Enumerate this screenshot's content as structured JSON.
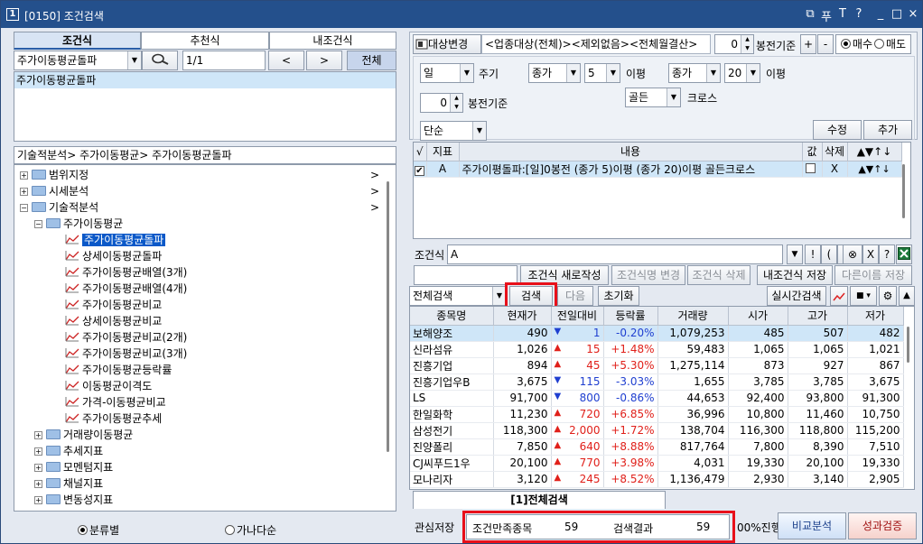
{
  "window": {
    "num": "1",
    "title": "[0150] 조건검색",
    "buttons": [
      "⧉",
      "푸",
      "T",
      "?",
      "_",
      "□",
      "×"
    ]
  },
  "left": {
    "tabs": [
      "조건식",
      "추천식",
      "내조건식"
    ],
    "search_combo": "주가이동평균돌파",
    "page": "1/1",
    "prev": "<",
    "next": ">",
    "all_btn": "전체",
    "selected_item": "주가이동평균돌파",
    "path": "기술적분석> 주가이동평균> 주가이동평균돌파",
    "tree": [
      {
        "label": "범위지정",
        "level": 0,
        "type": "folder",
        "arrow": ">"
      },
      {
        "label": "시세분석",
        "level": 0,
        "type": "folder",
        "arrow": ">"
      },
      {
        "label": "기술적분석",
        "level": 0,
        "type": "folder-open",
        "arrow": ">"
      },
      {
        "label": "주가이동평균",
        "level": 1,
        "type": "folder-open",
        "arrow": ""
      },
      {
        "label": "주가이동평균돌파",
        "level": 2,
        "type": "item",
        "selected": true
      },
      {
        "label": "상세이동평균돌파",
        "level": 2,
        "type": "item"
      },
      {
        "label": "주가이동평균배열(3개)",
        "level": 2,
        "type": "item"
      },
      {
        "label": "주가이동평균배열(4개)",
        "level": 2,
        "type": "item"
      },
      {
        "label": "주가이동평균비교",
        "level": 2,
        "type": "item"
      },
      {
        "label": "상세이동평균비교",
        "level": 2,
        "type": "item"
      },
      {
        "label": "주가이동평균비교(2개)",
        "level": 2,
        "type": "item"
      },
      {
        "label": "주가이동평균비교(3개)",
        "level": 2,
        "type": "item"
      },
      {
        "label": "주가이동평균등락률",
        "level": 2,
        "type": "item"
      },
      {
        "label": "이동평균이격도",
        "level": 2,
        "type": "item"
      },
      {
        "label": "가격-이동평균비교",
        "level": 2,
        "type": "item"
      },
      {
        "label": "주가이동평균추세",
        "level": 2,
        "type": "item"
      },
      {
        "label": "거래량이동평균",
        "level": 1,
        "type": "folder"
      },
      {
        "label": "추세지표",
        "level": 1,
        "type": "folder"
      },
      {
        "label": "모멘텀지표",
        "level": 1,
        "type": "folder"
      },
      {
        "label": "채널지표",
        "level": 1,
        "type": "folder"
      },
      {
        "label": "변동성지표",
        "level": 1,
        "type": "folder"
      }
    ],
    "radio_category": "분류별",
    "radio_alpha": "가나다순"
  },
  "top": {
    "target_btn": "대상변경",
    "target_text": "<업종대상(전체)><제외없음><전체월결산>",
    "bong_val": "0",
    "bong_label": "봉전기준",
    "plus": "+",
    "minus": "-",
    "buy": "매수",
    "sell": "매도"
  },
  "cond": {
    "period": "일",
    "period_label": "주기",
    "bong_val": "0",
    "bong_label": "봉전기준",
    "simple": "단순",
    "price1": "종가",
    "n1": "5",
    "ma1": "이평",
    "price2": "종가",
    "n2": "20",
    "ma2": "이평",
    "cross": "골든",
    "cross_label": "크로스",
    "edit_btn": "수정",
    "add_btn": "추가"
  },
  "cond_table": {
    "headers": [
      "√",
      "지표",
      "내용",
      "값",
      "삭제",
      "▲▼↑↓"
    ],
    "rows": [
      {
        "chk": "✔",
        "id": "A",
        "content": "주가이평돌파:[일]0봉전 (종가 5)이평 (종가 20)이평 골든크로스",
        "del": "X",
        "moves": "▲▼↑↓"
      }
    ]
  },
  "formula": {
    "label": "조건식",
    "value": "A",
    "ops": [
      "!",
      "(",
      ")",
      "⊗",
      "X",
      "?"
    ]
  },
  "actions": {
    "new": "조건식 새로작성",
    "rename": "조건식명 변경",
    "delete": "조건식 삭제",
    "save": "내조건식 저장",
    "save_as": "다른이름 저장"
  },
  "search": {
    "scope": "전체검색",
    "search_btn": "검색",
    "next_btn": "다음",
    "reset_btn": "초기화",
    "realtime_btn": "실시간검색"
  },
  "results": {
    "headers": [
      "종목명",
      "현재가",
      "전일대비",
      "등락률",
      "거래량",
      "시가",
      "고가",
      "저가"
    ],
    "rows": [
      {
        "name": "보해양조",
        "price": "490",
        "dir": "dn",
        "chg": "1",
        "rate": "-0.20%",
        "vol": "1,079,253",
        "open": "485",
        "high": "507",
        "low": "482"
      },
      {
        "name": "신라섬유",
        "price": "1,026",
        "dir": "up",
        "chg": "15",
        "rate": "+1.48%",
        "vol": "59,483",
        "open": "1,065",
        "high": "1,065",
        "low": "1,021"
      },
      {
        "name": "진흥기업",
        "price": "894",
        "dir": "up",
        "chg": "45",
        "rate": "+5.30%",
        "vol": "1,275,114",
        "open": "873",
        "high": "927",
        "low": "867"
      },
      {
        "name": "진흥기업우B",
        "price": "3,675",
        "dir": "dn",
        "chg": "115",
        "rate": "-3.03%",
        "vol": "1,655",
        "open": "3,785",
        "high": "3,785",
        "low": "3,675"
      },
      {
        "name": "LS",
        "price": "91,700",
        "dir": "dn",
        "chg": "800",
        "rate": "-0.86%",
        "vol": "44,653",
        "open": "92,400",
        "high": "93,800",
        "low": "91,300"
      },
      {
        "name": "한일화학",
        "price": "11,230",
        "dir": "up",
        "chg": "720",
        "rate": "+6.85%",
        "vol": "36,996",
        "open": "10,800",
        "high": "11,460",
        "low": "10,750"
      },
      {
        "name": "삼성전기",
        "price": "118,300",
        "dir": "up",
        "chg": "2,000",
        "rate": "+1.72%",
        "vol": "138,704",
        "open": "116,300",
        "high": "118,800",
        "low": "115,200"
      },
      {
        "name": "진양폴리",
        "price": "7,850",
        "dir": "up",
        "chg": "640",
        "rate": "+8.88%",
        "vol": "817,764",
        "open": "7,800",
        "high": "8,390",
        "low": "7,510"
      },
      {
        "name": "CJ씨푸드1우",
        "price": "20,100",
        "dir": "up",
        "chg": "770",
        "rate": "+3.98%",
        "vol": "4,031",
        "open": "19,330",
        "high": "20,100",
        "low": "19,330"
      },
      {
        "name": "모나리자",
        "price": "3,120",
        "dir": "up",
        "chg": "245",
        "rate": "+8.52%",
        "vol": "1,136,479",
        "open": "2,930",
        "high": "3,140",
        "low": "2,905"
      }
    ],
    "tab": "[1]전체검색"
  },
  "footer": {
    "interest_save": "관심저장",
    "match_label": "조건만족종목",
    "match_val": "59",
    "result_label": "검색결과",
    "result_val": "59",
    "progress": "00%진행",
    "compare_btn": "비교분석",
    "perf_btn": "성과검증"
  },
  "colors": {
    "titlebar": "#24508c",
    "up": "#e0201a",
    "down": "#1f3fd0",
    "highlight": "#e8101a",
    "selection": "#0a58c8"
  }
}
